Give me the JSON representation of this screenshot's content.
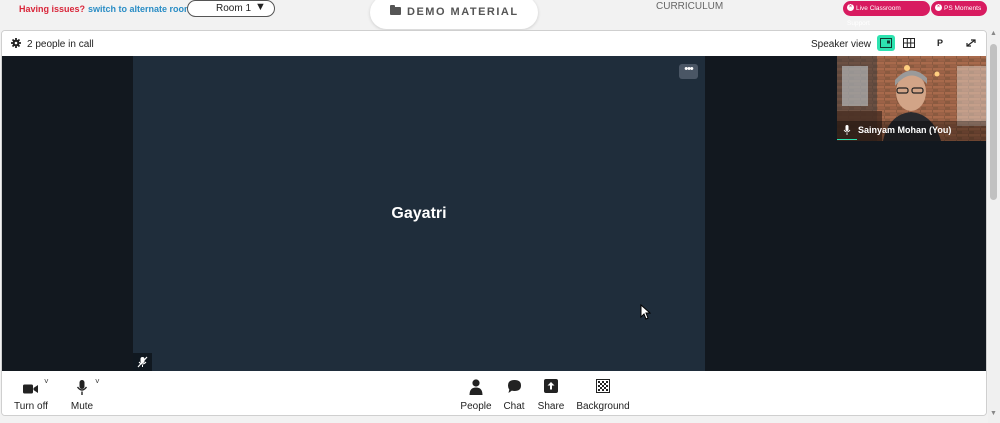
{
  "topbar": {
    "issue_prompt": "Having issues?",
    "alternate_link": "switch to alternate room",
    "room_selected": "Room 1",
    "demo_material": "DEMO MATERIAL",
    "curriculum": "CURRICULUM",
    "live_support": "Live Classroom Support",
    "ps_moments": "PS Moments"
  },
  "call": {
    "people_count": "2 people in call",
    "view_label": "Speaker view",
    "pin_label": "P",
    "speaker_name": "Gayatri",
    "self_name": "Sainyam Mohan (You)"
  },
  "controls": {
    "turn_off": "Turn off",
    "mute": "Mute",
    "people": "People",
    "chat": "Chat",
    "share": "Share",
    "background": "Background"
  },
  "colors": {
    "accent": "#2ee3b0",
    "pill": "#d81b60",
    "stage": "#12181f",
    "speaker_tile": "#1f2d3b"
  }
}
